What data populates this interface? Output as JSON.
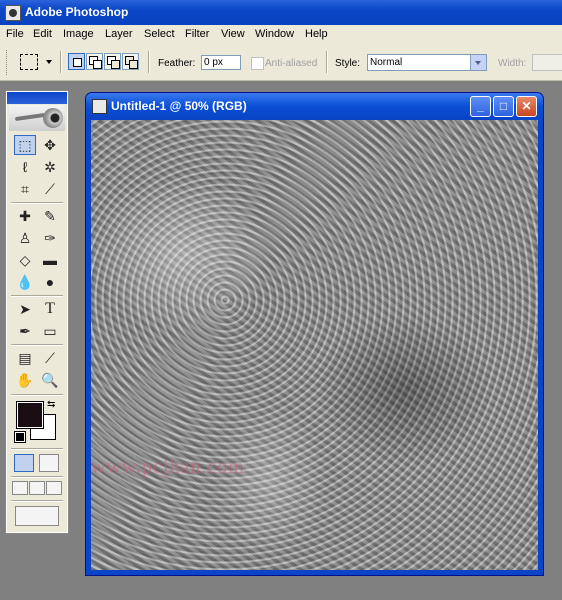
{
  "app": {
    "title": "Adobe Photoshop"
  },
  "menu": [
    "File",
    "Edit",
    "Image",
    "Layer",
    "Select",
    "Filter",
    "View",
    "Window",
    "Help"
  ],
  "options": {
    "feather_label": "Feather:",
    "feather_value": "0 px",
    "antialias_label": "Anti-aliased",
    "style_label": "Style:",
    "style_value": "Normal",
    "width_label": "Width:"
  },
  "document": {
    "title": "Untitled-1 @ 50% (RGB)",
    "watermark": "www.pcjhan.com"
  },
  "colors": {
    "foreground": "#1a0e14",
    "background": "#ffffff",
    "accent": "#0a46c8"
  },
  "tools": [
    "rect-marquee",
    "move",
    "lasso",
    "magic-wand",
    "crop",
    "slice",
    "healing-brush",
    "brush",
    "clone-stamp",
    "history-brush",
    "eraser",
    "gradient",
    "blur",
    "dodge",
    "path-selection",
    "type",
    "pen",
    "shape",
    "notes",
    "eyedropper",
    "hand",
    "zoom"
  ]
}
